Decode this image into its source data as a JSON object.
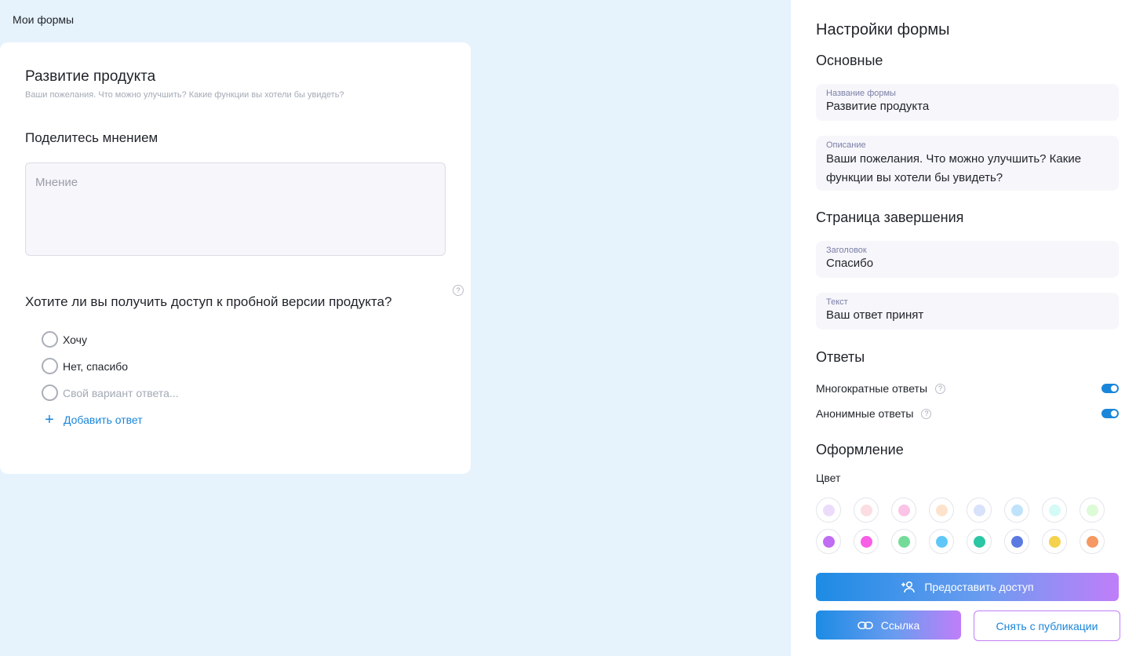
{
  "breadcrumb": "Мои формы",
  "form": {
    "title": "Развитие продукта",
    "description": "Ваши пожелания. Что можно улучшить? Какие функции вы хотели бы увидеть?",
    "q1": {
      "title": "Поделитесь мнением",
      "placeholder": "Мнение"
    },
    "q2": {
      "title": "Хотите ли вы получить доступ к пробной версии продукта?",
      "help": "?",
      "options": [
        "Хочу",
        "Нет, спасибо"
      ],
      "custom_placeholder": "Свой вариант ответа...",
      "add_label": "Добавить ответ"
    }
  },
  "settings": {
    "title": "Настройки формы",
    "basic": {
      "heading": "Основные",
      "name_label": "Название формы",
      "name_value": "Развитие продукта",
      "desc_label": "Описание",
      "desc_value": "Ваши пожелания. Что можно улучшить? Какие функции вы хотели бы увидеть?"
    },
    "finish": {
      "heading": "Страница завершения",
      "header_label": "Заголовок",
      "header_value": "Спасибо",
      "text_label": "Текст",
      "text_value": "Ваш ответ принят"
    },
    "answers": {
      "heading": "Ответы",
      "multiple_label": "Многократные ответы",
      "multiple_on": true,
      "anonymous_label": "Анонимные ответы",
      "anonymous_on": true
    },
    "design": {
      "heading": "Оформление",
      "color_label": "Цвет",
      "colors_row1": [
        "#ecdcfb",
        "#fbdde2",
        "#fbc3e6",
        "#fde3cd",
        "#d9e2fb",
        "#bfe3fb",
        "#d4fbf6",
        "#dcfbd6"
      ],
      "colors_row2": [
        "#c06cf3",
        "#f85ee6",
        "#74dc98",
        "#5fc7f8",
        "#2bc6a4",
        "#5a7ae2",
        "#f4d24e",
        "#f59862"
      ]
    },
    "buttons": {
      "share": "Предоставить доступ",
      "link": "Ссылка",
      "unpublish": "Снять с публикации"
    }
  }
}
